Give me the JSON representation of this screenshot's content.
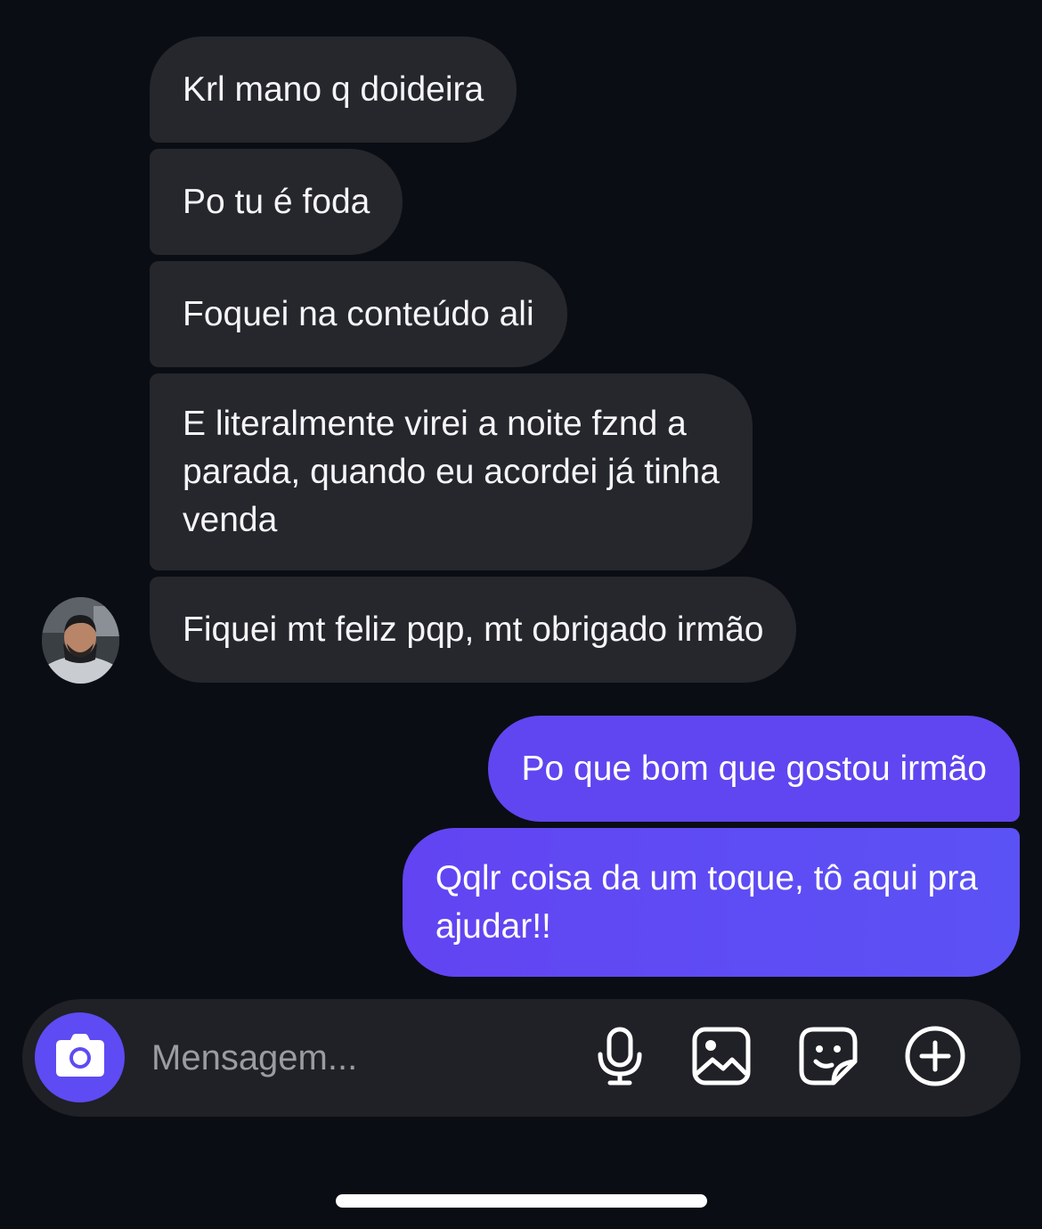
{
  "messages": {
    "incoming": [
      "Krl mano q doideira",
      "Po tu é foda",
      "Foquei na conteúdo ali",
      "E literalmente virei a noite fznd a\nparada, quando eu acordei já tinha\nvenda",
      "Fiquei mt feliz pqp, mt obrigado irmão"
    ],
    "outgoing": [
      "Po que bom que gostou irmão",
      "Qqlr coisa da um toque, tô aqui pra\najudar!!"
    ]
  },
  "composer": {
    "placeholder": "Mensagem...",
    "icons": [
      "camera-icon",
      "microphone-icon",
      "gallery-icon",
      "sticker-icon",
      "plus-circle-icon"
    ]
  },
  "colors": {
    "background": "#0b0d14",
    "incoming_bubble": "#25272d",
    "outgoing_bubble": "#5f46f0",
    "accent": "#5e4bf3"
  }
}
